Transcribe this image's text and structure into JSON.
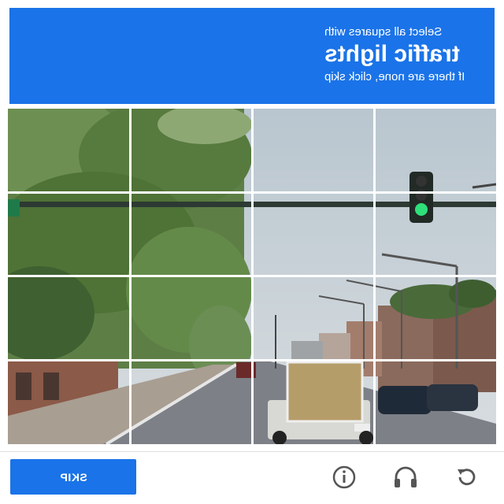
{
  "header": {
    "line1": "Select all squares with",
    "line2": "traffic lights",
    "line3": "If there are none, click skip"
  },
  "grid": {
    "rows": 4,
    "cols": 4
  },
  "footer": {
    "skip_label": "SKIP",
    "info_icon": "info-icon",
    "audio_icon": "headphones-icon",
    "reload_icon": "reload-icon"
  },
  "colors": {
    "accent": "#1a73e8"
  }
}
